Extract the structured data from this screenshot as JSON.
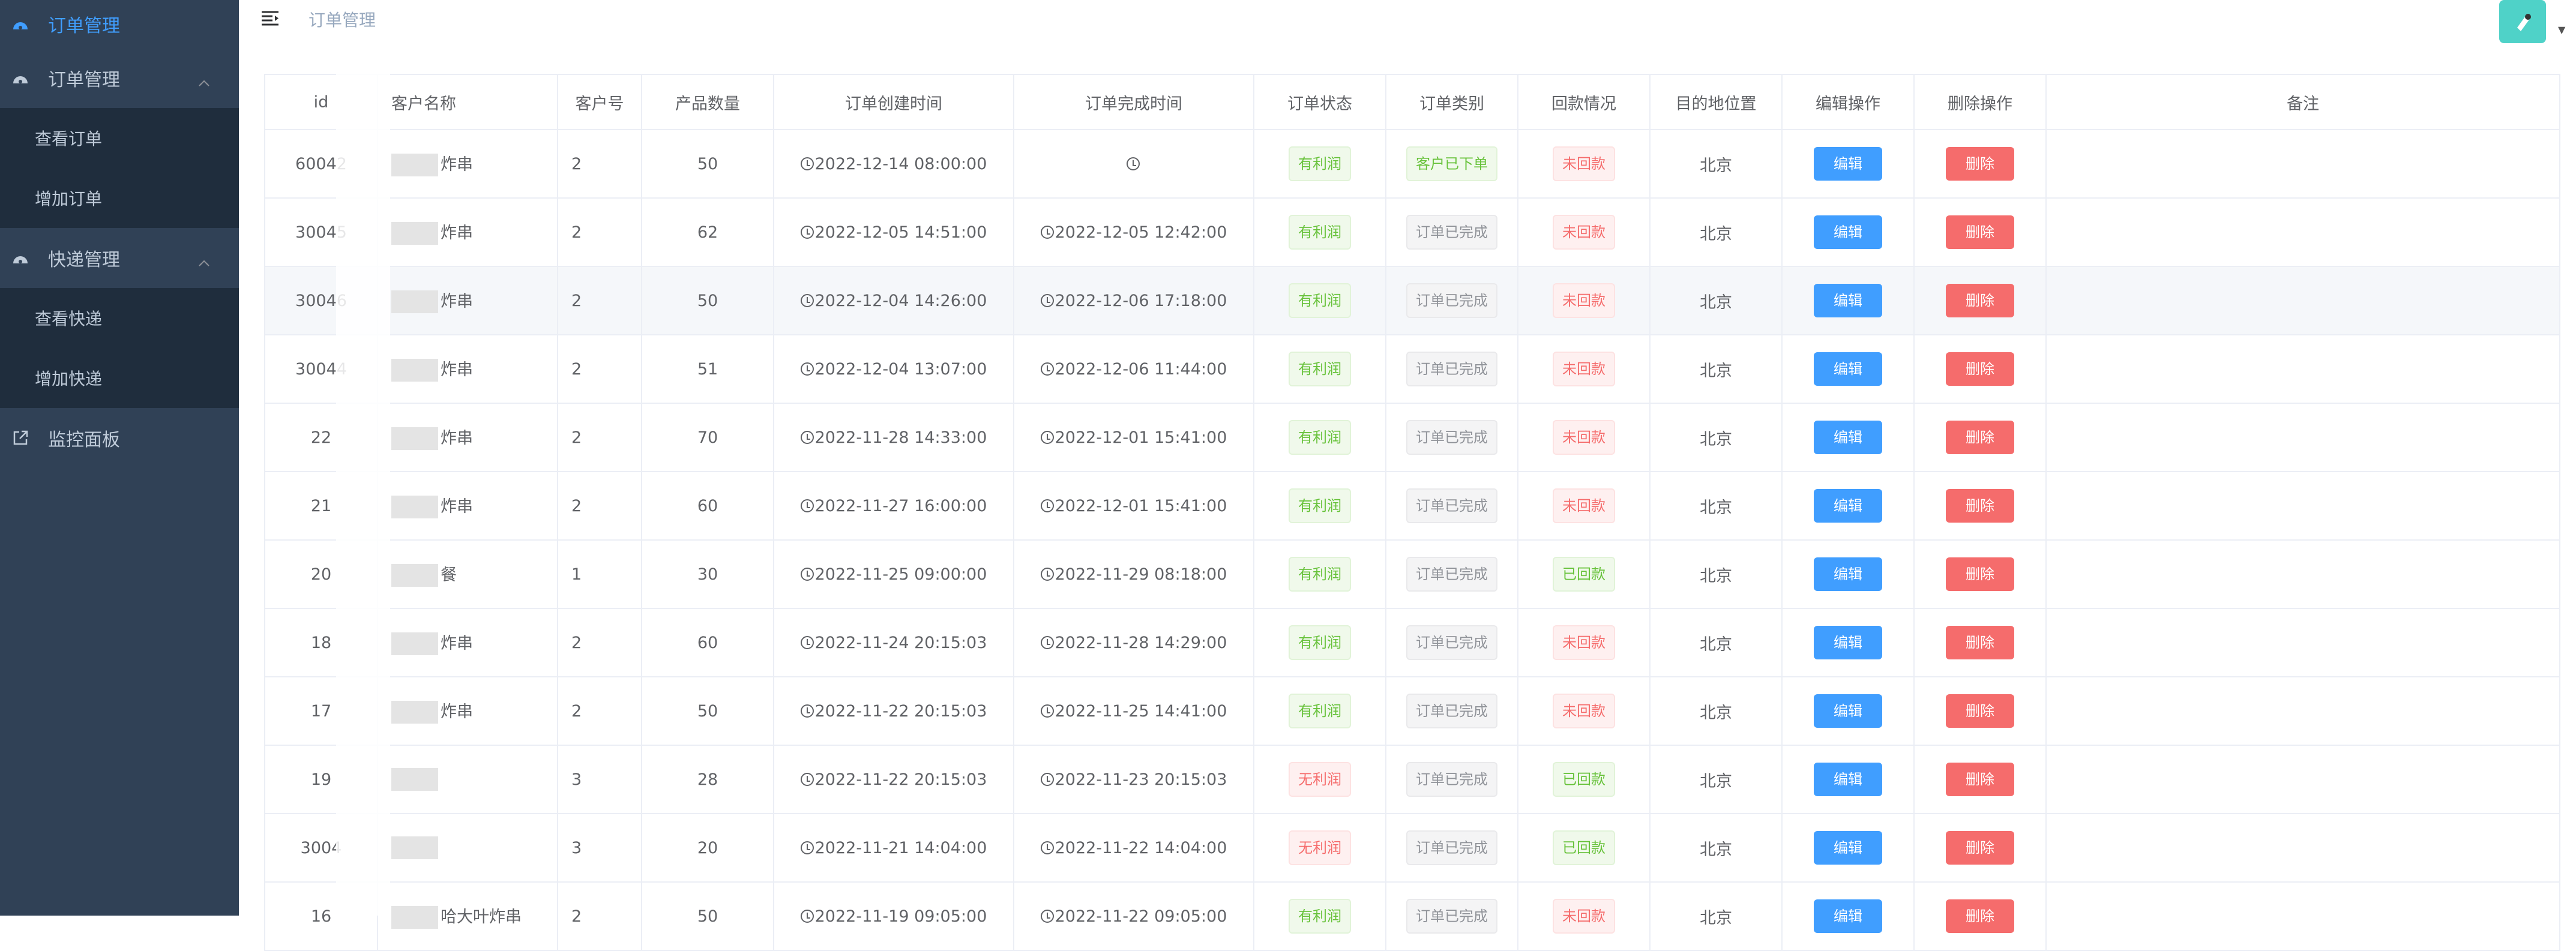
{
  "sidebar": {
    "top_label": "订单管理",
    "groups": [
      {
        "label": "订单管理",
        "items": [
          "查看订单",
          "增加订单"
        ]
      },
      {
        "label": "快递管理",
        "items": [
          "查看快递",
          "增加快递"
        ]
      }
    ],
    "monitor_label": "监控面板"
  },
  "header": {
    "breadcrumb": "订单管理"
  },
  "table": {
    "headers": [
      "id",
      "客户名称",
      "客户号",
      "产品数量",
      "订单创建时间",
      "订单完成时间",
      "订单状态",
      "订单类别",
      "回款情况",
      "目的地位置",
      "编辑操作",
      "删除操作",
      "备注"
    ],
    "edit_label": "编辑",
    "delete_label": "删除",
    "rows": [
      {
        "id": "60042",
        "name": "炸串",
        "cust": "2",
        "qty": "50",
        "created": "2022-12-14 08:00:00",
        "done": "",
        "status": "有利润",
        "status_type": "g",
        "cat": "客户已下单",
        "cat_type": "g",
        "pay": "未回款",
        "pay_type": "r",
        "dest": "北京"
      },
      {
        "id": "30045",
        "name": "炸串",
        "cust": "2",
        "qty": "62",
        "created": "2022-12-05 14:51:00",
        "done": "2022-12-05 12:42:00",
        "status": "有利润",
        "status_type": "g",
        "cat": "订单已完成",
        "cat_type": "i",
        "pay": "未回款",
        "pay_type": "r",
        "dest": "北京"
      },
      {
        "id": "30046",
        "name": "炸串",
        "cust": "2",
        "qty": "50",
        "created": "2022-12-04 14:26:00",
        "done": "2022-12-06 17:18:00",
        "status": "有利润",
        "status_type": "g",
        "cat": "订单已完成",
        "cat_type": "i",
        "pay": "未回款",
        "pay_type": "r",
        "dest": "北京"
      },
      {
        "id": "30044",
        "name": "炸串",
        "cust": "2",
        "qty": "51",
        "created": "2022-12-04 13:07:00",
        "done": "2022-12-06 11:44:00",
        "status": "有利润",
        "status_type": "g",
        "cat": "订单已完成",
        "cat_type": "i",
        "pay": "未回款",
        "pay_type": "r",
        "dest": "北京"
      },
      {
        "id": "22",
        "name": "炸串",
        "cust": "2",
        "qty": "70",
        "created": "2022-11-28 14:33:00",
        "done": "2022-12-01 15:41:00",
        "status": "有利润",
        "status_type": "g",
        "cat": "订单已完成",
        "cat_type": "i",
        "pay": "未回款",
        "pay_type": "r",
        "dest": "北京"
      },
      {
        "id": "21",
        "name": "炸串",
        "cust": "2",
        "qty": "60",
        "created": "2022-11-27 16:00:00",
        "done": "2022-12-01 15:41:00",
        "status": "有利润",
        "status_type": "g",
        "cat": "订单已完成",
        "cat_type": "i",
        "pay": "未回款",
        "pay_type": "r",
        "dest": "北京"
      },
      {
        "id": "20",
        "name": "餐",
        "cust": "1",
        "qty": "30",
        "created": "2022-11-25 09:00:00",
        "done": "2022-11-29 08:18:00",
        "status": "有利润",
        "status_type": "g",
        "cat": "订单已完成",
        "cat_type": "i",
        "pay": "已回款",
        "pay_type": "g",
        "dest": "北京"
      },
      {
        "id": "18",
        "name": "炸串",
        "cust": "2",
        "qty": "60",
        "created": "2022-11-24 20:15:03",
        "done": "2022-11-28 14:29:00",
        "status": "有利润",
        "status_type": "g",
        "cat": "订单已完成",
        "cat_type": "i",
        "pay": "未回款",
        "pay_type": "r",
        "dest": "北京"
      },
      {
        "id": "17",
        "name": "炸串",
        "cust": "2",
        "qty": "50",
        "created": "2022-11-22 20:15:03",
        "done": "2022-11-25 14:41:00",
        "status": "有利润",
        "status_type": "g",
        "cat": "订单已完成",
        "cat_type": "i",
        "pay": "未回款",
        "pay_type": "r",
        "dest": "北京"
      },
      {
        "id": "19",
        "name": "",
        "cust": "3",
        "qty": "28",
        "created": "2022-11-22 20:15:03",
        "done": "2022-11-23 20:15:03",
        "status": "无利润",
        "status_type": "r",
        "cat": "订单已完成",
        "cat_type": "i",
        "pay": "已回款",
        "pay_type": "g",
        "dest": "北京"
      },
      {
        "id": "3004",
        "name": "",
        "cust": "3",
        "qty": "20",
        "created": "2022-11-21 14:04:00",
        "done": "2022-11-22 14:04:00",
        "status": "无利润",
        "status_type": "r",
        "cat": "订单已完成",
        "cat_type": "i",
        "pay": "已回款",
        "pay_type": "g",
        "dest": "北京"
      },
      {
        "id": "16",
        "name": "哈大叶炸串",
        "cust": "2",
        "qty": "50",
        "created": "2022-11-19 09:05:00",
        "done": "2022-11-22 09:05:00",
        "status": "有利润",
        "status_type": "g",
        "cat": "订单已完成",
        "cat_type": "i",
        "pay": "未回款",
        "pay_type": "r",
        "dest": "北京"
      }
    ]
  },
  "colors": {
    "sidebar_bg": "#304156",
    "submenu_bg": "#1f2d3d",
    "active": "#409eff",
    "success": "#67c23a",
    "danger": "#f56c6c",
    "avatar": "#4fd2c8"
  }
}
